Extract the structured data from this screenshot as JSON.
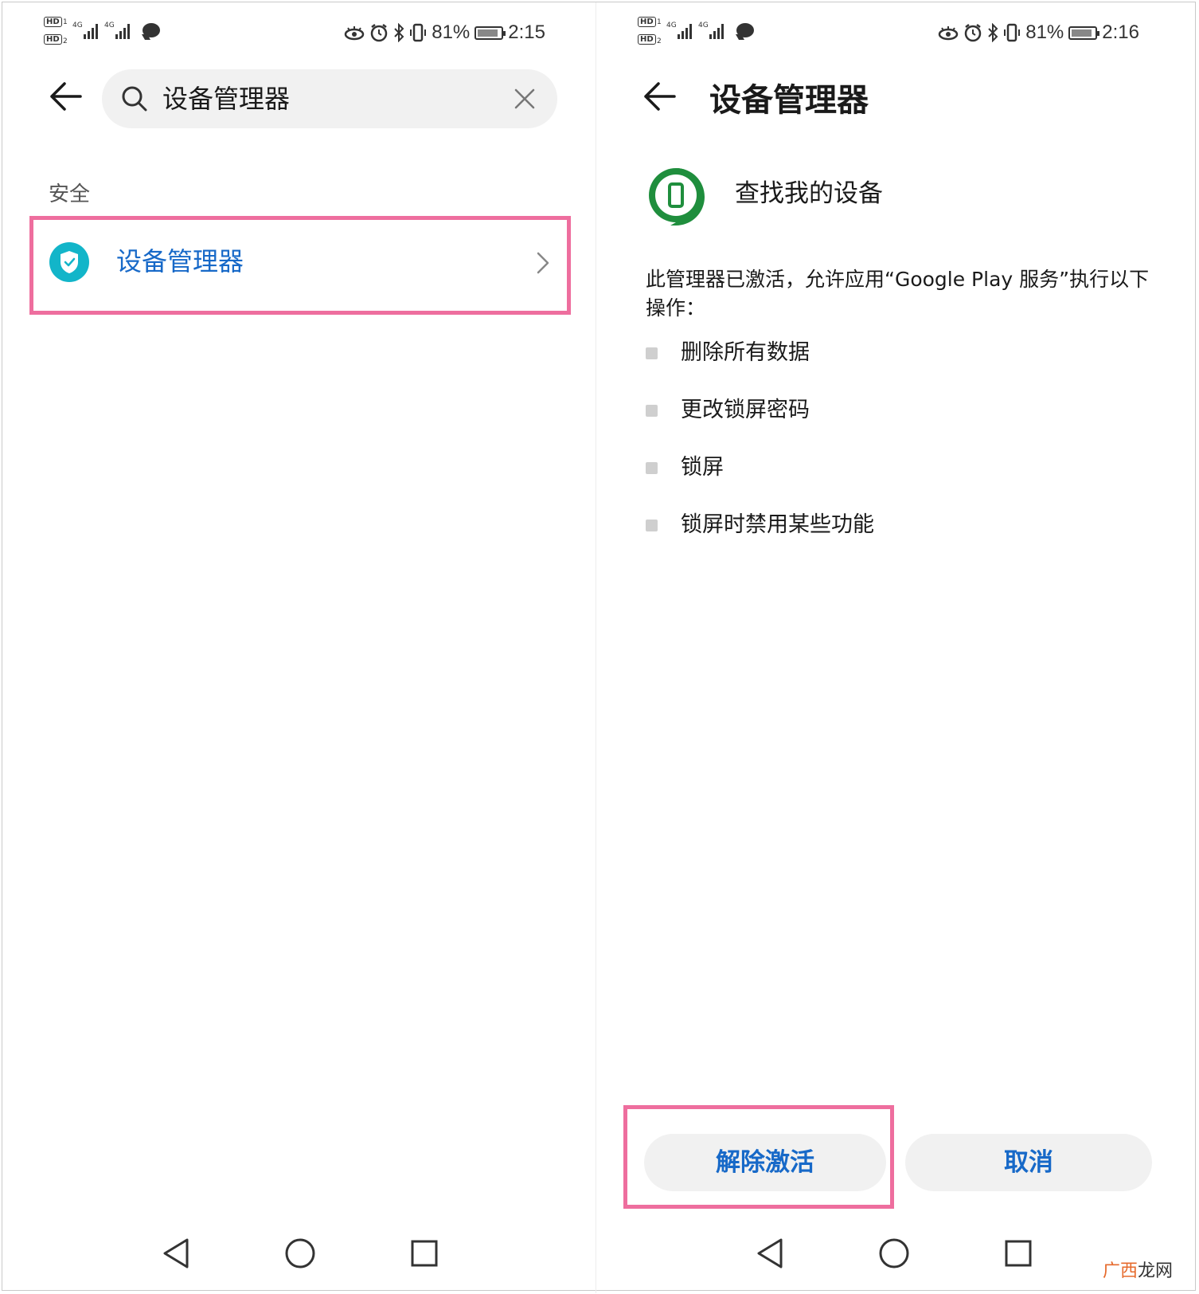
{
  "left_screen": {
    "status": {
      "time": "2:15",
      "battery": "81%"
    },
    "search": {
      "value": "设备管理器"
    },
    "section_label": "安全",
    "result_label": "设备管理器"
  },
  "right_screen": {
    "status": {
      "time": "2:16",
      "battery": "81%"
    },
    "title": "设备管理器",
    "app_name": "查找我的设备",
    "description": "此管理器已激活，允许应用“Google Play 服务”执行以下操作：",
    "permissions": [
      "删除所有数据",
      "更改锁屏密码",
      "锁屏",
      "锁屏时禁用某些功能"
    ],
    "deactivate_label": "解除激活",
    "cancel_label": "取消"
  },
  "watermark": {
    "part1": "广西",
    "part2": "龙网"
  },
  "colors": {
    "accent": "#1769c8",
    "highlight": "#ee6e9e",
    "teal": "#12b5c9",
    "green": "#1f8e3d"
  },
  "icons": [
    "back-arrow-icon",
    "search-icon",
    "close-icon",
    "shield-check-icon",
    "chevron-right-icon",
    "find-my-device-icon",
    "nav-back-icon",
    "nav-home-icon",
    "nav-recents-icon"
  ]
}
